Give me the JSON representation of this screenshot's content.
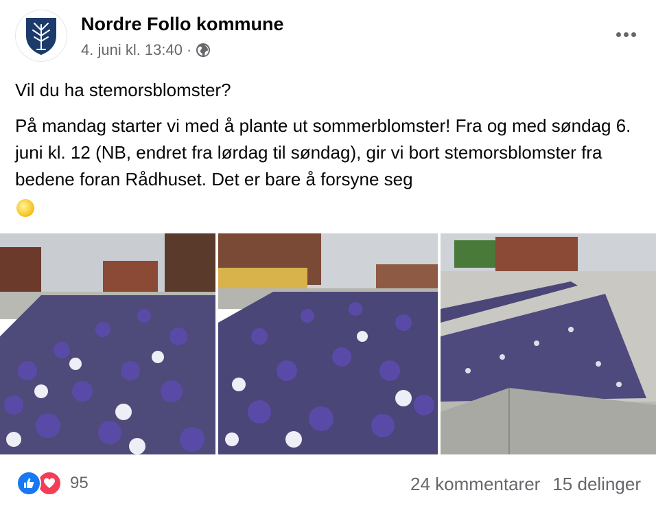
{
  "post": {
    "page_name": "Nordre Follo kommune",
    "timestamp": "4. juni kl. 13:40",
    "separator": "·",
    "privacy_icon": "globe-icon",
    "more_icon": "more-options-icon",
    "question": "Vil du ha stemorsblomster?",
    "body": "På mandag starter vi med å plante ut sommerblomster! Fra og med søndag 6. juni kl. 12 (NB, endret fra lørdag til søndag), gir vi bort stemorsblomster fra bedene foran Rådhuset. Det er bare å forsyne seg",
    "emoji": "sun-emoji"
  },
  "photos": [
    {
      "name": "pansy-bed-photo-1"
    },
    {
      "name": "pansy-bed-photo-2"
    },
    {
      "name": "pansy-bed-photo-3"
    }
  ],
  "footer": {
    "reaction_icons": [
      "like-icon",
      "love-icon"
    ],
    "reaction_count": "95",
    "comments": "24 kommentarer",
    "shares": "15 delinger"
  },
  "colors": {
    "text": "#050505",
    "secondary": "#65676b",
    "like": "#1877f2",
    "love": "#f33e58",
    "crest": "#1c3a6b",
    "pansy_purple": "#5a4aa8",
    "pansy_white": "#eeeef6"
  }
}
